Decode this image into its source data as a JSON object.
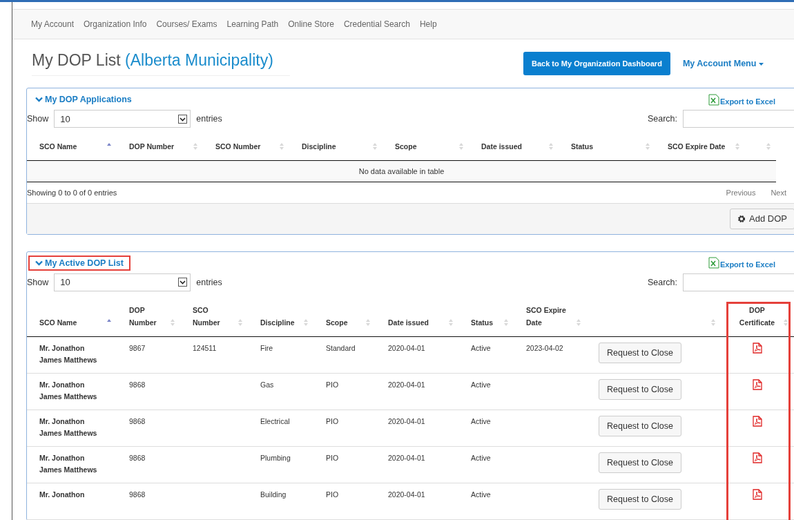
{
  "nav": [
    "My Account",
    "Organization Info",
    "Courses/ Exams",
    "Learning Path",
    "Online Store",
    "Credential Search",
    "Help"
  ],
  "title": "My DOP List",
  "organization": "(Alberta Municipality)",
  "dashboard_button": "Back to My Organization Dashboard",
  "account_menu": "My Account Menu",
  "applications": {
    "heading": "My DOP Applications",
    "highlighted": false,
    "export": "Export to Excel",
    "show_label": "Show",
    "page_size": "10",
    "entries_label": "entries",
    "search_label": "Search:",
    "columns": [
      {
        "label": "SCO Name",
        "sorted": true
      },
      {
        "label": "DOP Number",
        "sorted": false
      },
      {
        "label": "SCO Number",
        "sorted": false
      },
      {
        "label": "Discipline",
        "sorted": false
      },
      {
        "label": "Scope",
        "sorted": false
      },
      {
        "label": "Date issued",
        "sorted": false
      },
      {
        "label": "Status",
        "sorted": false
      },
      {
        "label": "SCO Expire Date",
        "sorted": false
      },
      {
        "sorted": false
      }
    ],
    "empty_message": "No data available in table",
    "info": "Showing 0 to 0 of 0 entries",
    "previous": "Previous",
    "next": "Next",
    "add_button": "Add DOP"
  },
  "active": {
    "heading": "My Active DOP List",
    "highlighted": true,
    "export": "Export to Excel",
    "show_label": "Show",
    "page_size": "10",
    "entries_label": "entries",
    "search_label": "Search:",
    "columns": [
      {
        "label": "SCO Name",
        "sorted": true,
        "highlighted": false
      },
      {
        "label": "DOP Number",
        "sorted": false,
        "highlighted": false
      },
      {
        "label": "SCO Number",
        "sorted": false,
        "highlighted": false
      },
      {
        "label": "Discipline",
        "sorted": false,
        "highlighted": false
      },
      {
        "label": "Scope",
        "sorted": false,
        "highlighted": false
      },
      {
        "label": "Date issued",
        "sorted": false,
        "highlighted": false
      },
      {
        "label": "Status",
        "sorted": false,
        "highlighted": false
      },
      {
        "label": "SCO Expire Date",
        "sorted": false,
        "highlighted": false
      },
      {
        "sorted": false,
        "highlighted": false
      },
      {
        "label": "DOP Certificate",
        "sorted": false,
        "highlighted": true
      }
    ],
    "rows": [
      {
        "sco_name": "Mr. Jonathon James Matthews",
        "dop_number": "9867",
        "sco_number": "124511",
        "discipline": "Fire",
        "scope": "Standard",
        "date_issued": "2020-04-01",
        "status": "Active",
        "expire_date": "2023-04-02",
        "action": "Request to Close"
      },
      {
        "sco_name": "Mr. Jonathon James Matthews",
        "dop_number": "9868",
        "discipline": "Gas",
        "scope": "PIO",
        "date_issued": "2020-04-01",
        "status": "Active",
        "action": "Request to Close"
      },
      {
        "sco_name": "Mr. Jonathon James Matthews",
        "dop_number": "9868",
        "discipline": "Electrical",
        "scope": "PIO",
        "date_issued": "2020-04-01",
        "status": "Active",
        "action": "Request to Close"
      },
      {
        "sco_name": "Mr. Jonathon James Matthews",
        "dop_number": "9868",
        "discipline": "Plumbing",
        "scope": "PIO",
        "date_issued": "2020-04-01",
        "status": "Active",
        "action": "Request to Close"
      },
      {
        "sco_name": "Mr. Jonathon",
        "dop_number": "9868",
        "discipline": "Building",
        "scope": "PIO",
        "date_issued": "2020-04-01",
        "status": "Active",
        "action": "Request to Close"
      }
    ]
  }
}
